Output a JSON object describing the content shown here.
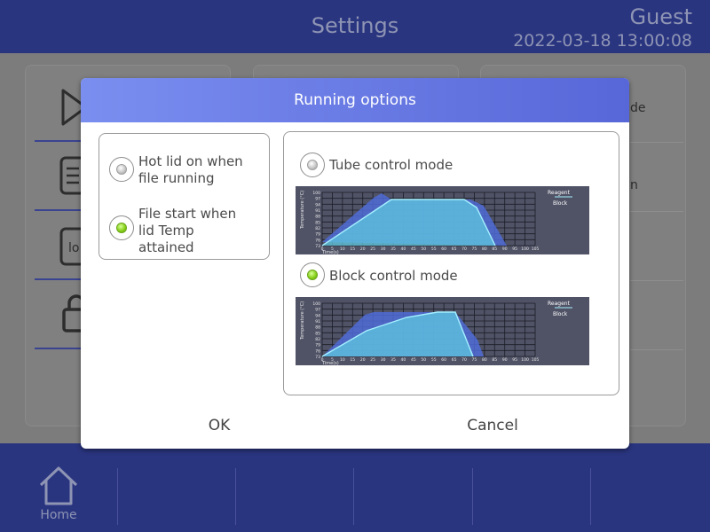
{
  "header": {
    "title": "Settings",
    "user": "Guest",
    "datetime": "2022-03-18 13:00:08"
  },
  "background": {
    "right_panel_texts": [
      "de",
      "n"
    ]
  },
  "footer": {
    "home_label": "Home"
  },
  "dialog": {
    "title": "Running options",
    "left_options": [
      {
        "label_lines": [
          "Hot lid on when",
          "file running"
        ],
        "selected": false
      },
      {
        "label_lines": [
          "File start when",
          "lid Temp",
          "attained"
        ],
        "selected": true
      }
    ],
    "modes": [
      {
        "label": "Tube control mode",
        "selected": false
      },
      {
        "label": "Block control mode",
        "selected": true
      }
    ],
    "ok_label": "OK",
    "cancel_label": "Cancel"
  },
  "charts": {
    "tube": {
      "legend": [
        "Reagent",
        "Block"
      ],
      "y_ticks": [
        "100",
        "97",
        "94",
        "91",
        "88",
        "85",
        "82",
        "79",
        "76",
        "73"
      ],
      "x_ticks": [
        "0",
        "5",
        "10",
        "15",
        "20",
        "25",
        "30",
        "35",
        "40",
        "45",
        "50",
        "55",
        "60",
        "65",
        "70",
        "75",
        "80",
        "85",
        "90",
        "95",
        "100",
        "105"
      ],
      "y_label": "Temperature (°C)",
      "x_label": "Time(s)"
    },
    "block": {
      "legend": [
        "Reagent",
        "Block"
      ],
      "y_ticks": [
        "100",
        "97",
        "94",
        "91",
        "88",
        "85",
        "82",
        "79",
        "76",
        "73"
      ],
      "x_ticks": [
        "0",
        "5",
        "10",
        "15",
        "20",
        "25",
        "30",
        "35",
        "40",
        "45",
        "50",
        "55",
        "60",
        "65",
        "70",
        "75",
        "80",
        "85",
        "90",
        "95",
        "100",
        "105"
      ],
      "y_label": "Temperature (°C)",
      "x_label": "Time(s)"
    }
  },
  "colors": {
    "header_bg": "#2a3580",
    "dialog_header_start": "#7a8ef0",
    "dialog_header_end": "#5867d8",
    "radio_selected": "#88d11a",
    "chart_bg": "#505366"
  }
}
